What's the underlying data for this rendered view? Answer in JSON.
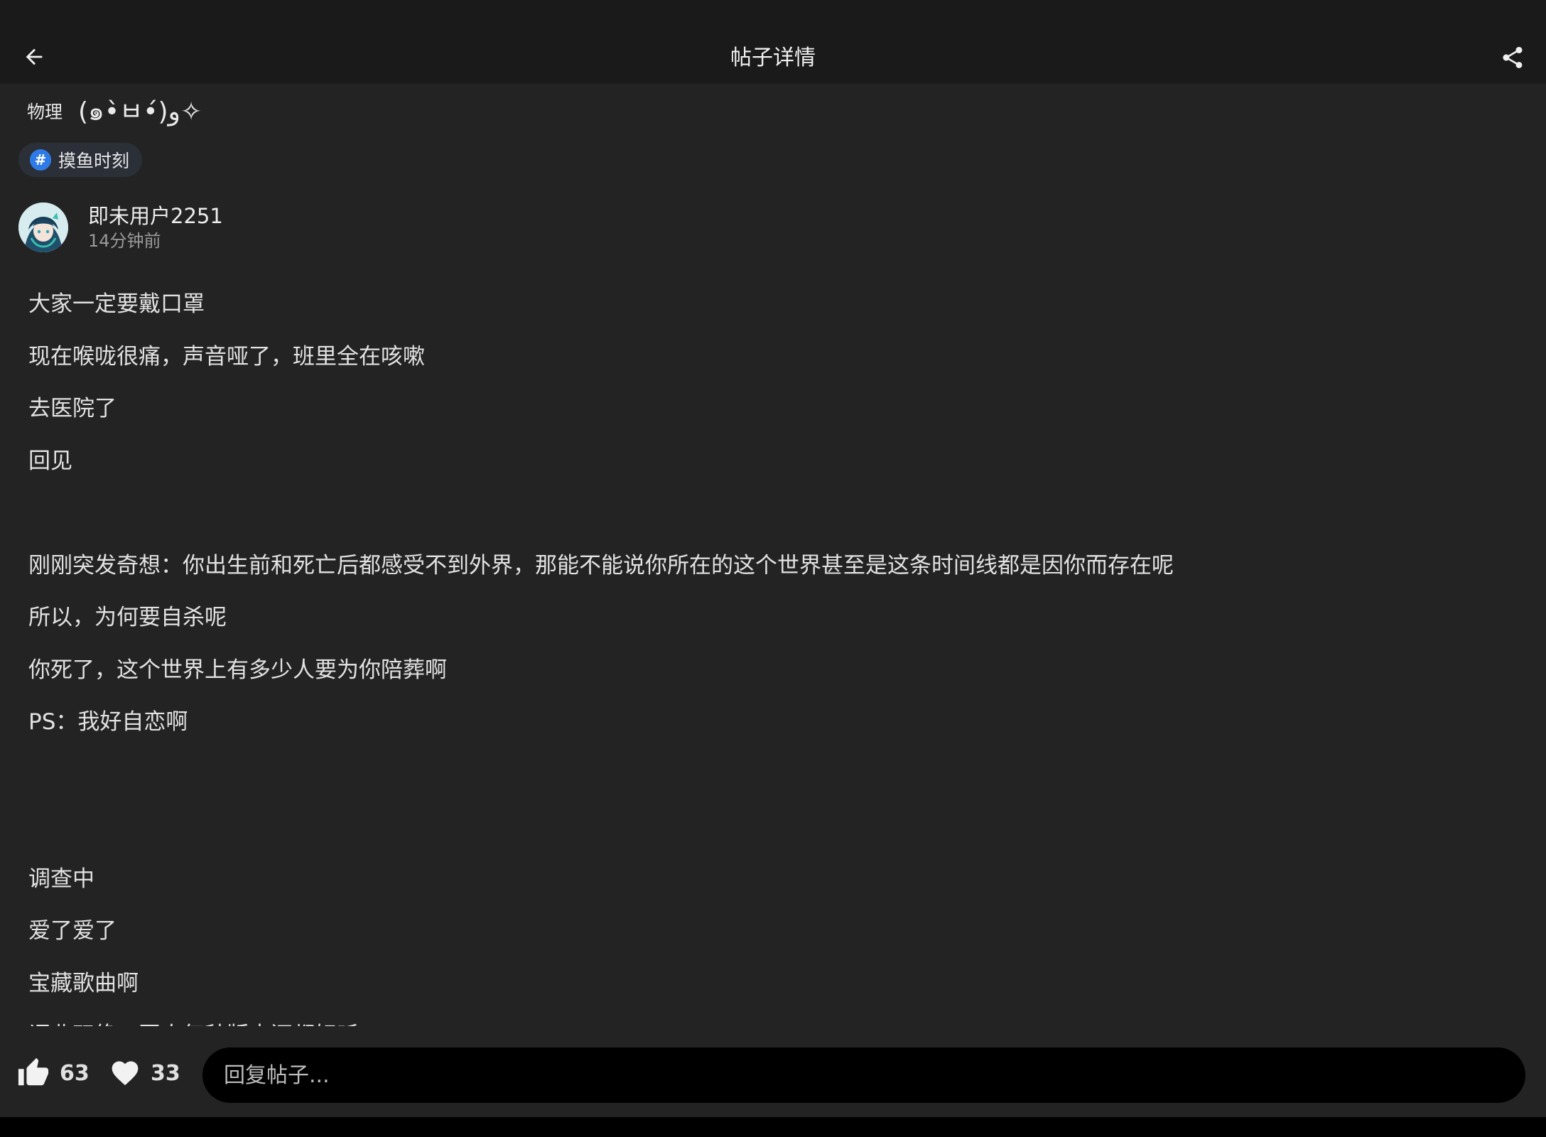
{
  "header": {
    "title": "帖子详情",
    "back_icon": "arrow-left-icon",
    "share_icon": "share-icon"
  },
  "post": {
    "subject": "物理",
    "kaomoji": "(๑•̀ㅂ•́)و✧",
    "topic": "摸鱼时刻",
    "author": {
      "name": "即未用户2251",
      "time": "14分钟前"
    },
    "lines": [
      "大家一定要戴口罩",
      "现在喉咙很痛，声音哑了，班里全在咳嗽",
      "去医院了",
      "回见",
      "",
      "刚刚突发奇想：你出生前和死亡后都感受不到外界，那能不能说你所在的这个世界甚至是这条时间线都是因你而存在呢",
      "所以，为何要自杀呢",
      "你死了，这个世界上有多少人要为你陪葬啊",
      "PS：我好自恋啊",
      "",
      "",
      "调查中",
      "爱了爱了",
      "宝藏歌曲啊",
      "词曲双绝，国人每种版本还都好听"
    ]
  },
  "actions": {
    "likes": "63",
    "favorites": "33"
  },
  "reply": {
    "placeholder": "回复帖子..."
  },
  "colors": {
    "background": "#232323",
    "topbar": "#1a1a1a",
    "tag_accent": "#2e7be8",
    "reply_box": "#000000"
  }
}
